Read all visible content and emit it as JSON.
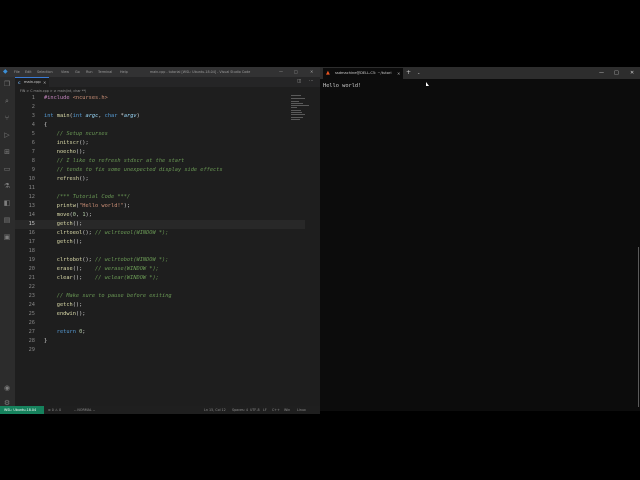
{
  "vscode": {
    "menu": [
      "File",
      "Edit",
      "Selection",
      "View",
      "Go",
      "Run",
      "Terminal",
      "Help"
    ],
    "window_title": "main.cpp - tutorial [WSL: Ubuntu-18.04] - Visual Studio Code",
    "tab_label": "main.cpp",
    "tab_icon": "C",
    "breadcrumb": "FIN > C main.cpp > ⊘ main(int, char **)",
    "logo_icon": "vscode-logo-icon",
    "activity_icons": [
      "files-icon",
      "search-icon",
      "source-control-icon",
      "run-debug-icon",
      "extensions-icon",
      "remote-explorer-icon",
      "testing-icon",
      "bookmarks-icon",
      "folder-icon",
      "terminal-icon"
    ],
    "account_icon": "account-icon",
    "settings_icon": "gear-icon",
    "current_line": 15,
    "code_lines": [
      {
        "n": "1",
        "tokens": [
          [
            "pp",
            "#include "
          ],
          [
            "str",
            "<ncurses.h>"
          ]
        ]
      },
      {
        "n": "2",
        "tokens": []
      },
      {
        "n": "3",
        "tokens": [
          [
            "kw",
            "int "
          ],
          [
            "fn",
            "main"
          ],
          [
            "pl",
            "("
          ],
          [
            "kw",
            "int "
          ],
          [
            "var",
            "argc"
          ],
          [
            "pl",
            ", "
          ],
          [
            "kw",
            "char "
          ],
          [
            "pl",
            "*"
          ],
          [
            "var",
            "argv"
          ],
          [
            "pl",
            ")"
          ]
        ]
      },
      {
        "n": "4",
        "tokens": [
          [
            "pl",
            "{"
          ]
        ]
      },
      {
        "n": "5",
        "tokens": [
          [
            "pl",
            "    "
          ],
          [
            "com",
            "// Setup ncurses"
          ]
        ]
      },
      {
        "n": "6",
        "tokens": [
          [
            "pl",
            "    "
          ],
          [
            "fn",
            "initscr"
          ],
          [
            "pl",
            "();"
          ]
        ]
      },
      {
        "n": "7",
        "tokens": [
          [
            "pl",
            "    "
          ],
          [
            "fn",
            "noecho"
          ],
          [
            "pl",
            "();"
          ]
        ]
      },
      {
        "n": "8",
        "tokens": [
          [
            "pl",
            "    "
          ],
          [
            "com",
            "// I like to refresh stdscr at the start"
          ]
        ]
      },
      {
        "n": "9",
        "tokens": [
          [
            "pl",
            "    "
          ],
          [
            "com",
            "// tends to fix some unexpected display side effects"
          ]
        ]
      },
      {
        "n": "10",
        "tokens": [
          [
            "pl",
            "    "
          ],
          [
            "fn",
            "refresh"
          ],
          [
            "pl",
            "();"
          ]
        ]
      },
      {
        "n": "11",
        "tokens": []
      },
      {
        "n": "12",
        "tokens": [
          [
            "pl",
            "    "
          ],
          [
            "com",
            "/*** Tutorial Code ***/"
          ]
        ]
      },
      {
        "n": "13",
        "tokens": [
          [
            "pl",
            "    "
          ],
          [
            "fn",
            "printw"
          ],
          [
            "pl",
            "("
          ],
          [
            "str",
            "\"Hello world!\""
          ],
          [
            "pl",
            ");"
          ]
        ]
      },
      {
        "n": "14",
        "tokens": [
          [
            "pl",
            "    "
          ],
          [
            "fn",
            "move"
          ],
          [
            "pl",
            "("
          ],
          [
            "num",
            "0"
          ],
          [
            "pl",
            ", "
          ],
          [
            "num",
            "1"
          ],
          [
            "pl",
            ");"
          ]
        ]
      },
      {
        "n": "15",
        "tokens": [
          [
            "pl",
            "    "
          ],
          [
            "fn",
            "getch"
          ],
          [
            "pl",
            "();"
          ]
        ]
      },
      {
        "n": "16",
        "tokens": [
          [
            "pl",
            "    "
          ],
          [
            "fn",
            "clrtoeol"
          ],
          [
            "pl",
            "(); "
          ],
          [
            "com",
            "// wclrtoeol(WINDOW *);"
          ]
        ]
      },
      {
        "n": "17",
        "tokens": [
          [
            "pl",
            "    "
          ],
          [
            "fn",
            "getch"
          ],
          [
            "pl",
            "();"
          ]
        ]
      },
      {
        "n": "18",
        "tokens": []
      },
      {
        "n": "19",
        "tokens": [
          [
            "pl",
            "    "
          ],
          [
            "fn",
            "clrtobot"
          ],
          [
            "pl",
            "(); "
          ],
          [
            "com",
            "// wclrtobot(WINDOW *);"
          ]
        ]
      },
      {
        "n": "20",
        "tokens": [
          [
            "pl",
            "    "
          ],
          [
            "fn",
            "erase"
          ],
          [
            "pl",
            "();    "
          ],
          [
            "com",
            "// werase(WINDOW *);"
          ]
        ]
      },
      {
        "n": "21",
        "tokens": [
          [
            "pl",
            "    "
          ],
          [
            "fn",
            "clear"
          ],
          [
            "pl",
            "();    "
          ],
          [
            "com",
            "// wclear(WINDOW *);"
          ]
        ]
      },
      {
        "n": "22",
        "tokens": []
      },
      {
        "n": "23",
        "tokens": [
          [
            "pl",
            "    "
          ],
          [
            "com",
            "// Make sure to pause before exiting"
          ]
        ]
      },
      {
        "n": "24",
        "tokens": [
          [
            "pl",
            "    "
          ],
          [
            "fn",
            "getch"
          ],
          [
            "pl",
            "();"
          ]
        ]
      },
      {
        "n": "25",
        "tokens": [
          [
            "pl",
            "    "
          ],
          [
            "fn",
            "endwin"
          ],
          [
            "pl",
            "();"
          ]
        ]
      },
      {
        "n": "26",
        "tokens": []
      },
      {
        "n": "27",
        "tokens": [
          [
            "pl",
            "    "
          ],
          [
            "kw",
            "return "
          ],
          [
            "num",
            "0"
          ],
          [
            "pl",
            ";"
          ]
        ]
      },
      {
        "n": "28",
        "tokens": [
          [
            "pl",
            "}"
          ]
        ]
      },
      {
        "n": "29",
        "tokens": []
      }
    ],
    "status": {
      "remote": "WSL: Ubuntu-18.04",
      "problems": "⊗ 0 ⚠ 0",
      "vim_mode": "-- NORMAL --",
      "position": "Ln 15, Col 12",
      "spaces": "Spaces: 4",
      "encoding": "UTF-8",
      "eol": "LF",
      "language": "C++",
      "platform": "Win",
      "os": "Linux"
    }
  },
  "terminal": {
    "tab_label": "ssdmachine@DELL-C5: ~/tutori",
    "tab_icon": "linux-icon",
    "output": "Hello world!"
  }
}
